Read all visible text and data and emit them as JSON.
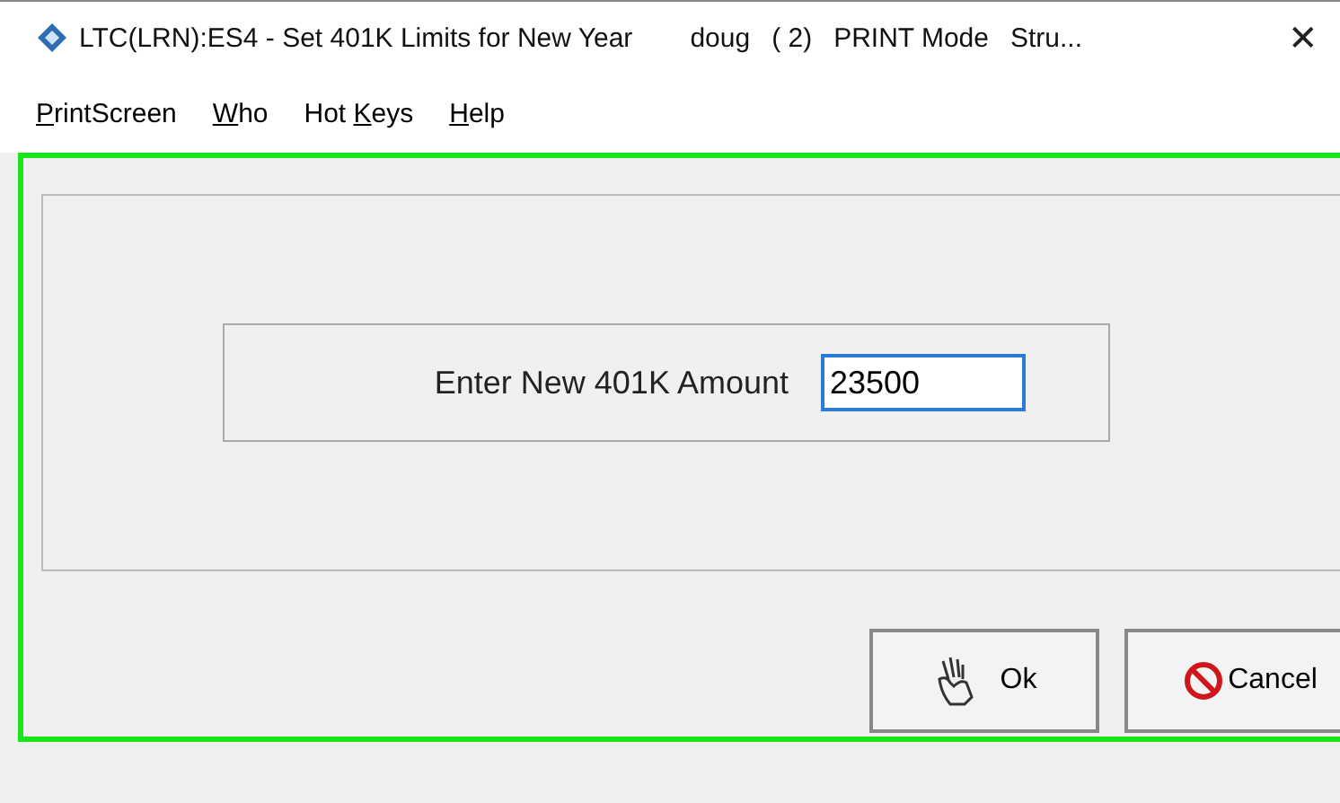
{
  "window": {
    "title": "LTC(LRN):ES4 - Set 401K Limits for New Year",
    "user": "doug",
    "session": "( 2)",
    "mode": "PRINT Mode",
    "extra": "Stru...",
    "close": "✕"
  },
  "menu": [
    {
      "key": "P",
      "after": "rintScreen"
    },
    {
      "key": "W",
      "after": "ho"
    },
    {
      "before": "Hot ",
      "key": "K",
      "after": "eys"
    },
    {
      "key": "H",
      "after": "elp"
    }
  ],
  "form": {
    "label": "Enter New 401K Amount",
    "value": "23500"
  },
  "buttons": [
    {
      "kind": "ok",
      "label": "Ok"
    },
    {
      "kind": "cancel",
      "label": "Cancel"
    }
  ]
}
